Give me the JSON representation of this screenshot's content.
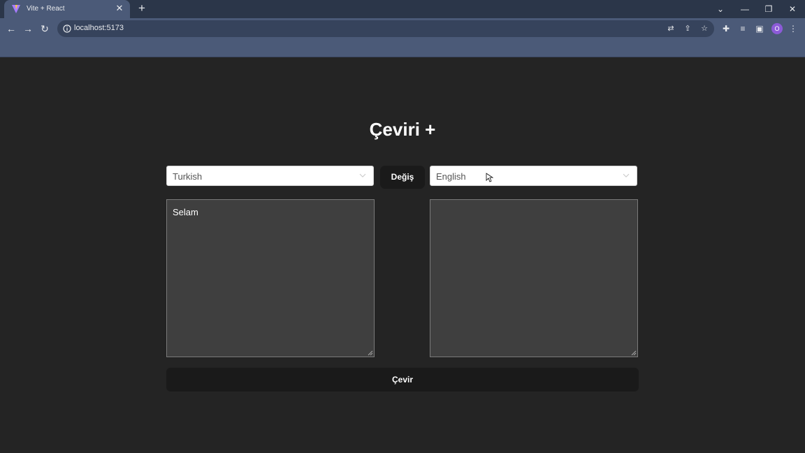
{
  "browser": {
    "tab_title": "Vite + React",
    "url": "localhost:5173",
    "profile_initial": "O",
    "icons": {
      "tab_close": "close-icon",
      "new_tab": "plus-icon",
      "tab_search": "chevron-down-icon",
      "minimize": "minimize-icon",
      "restore": "restore-icon",
      "close_window": "close-icon",
      "back": "back-arrow-icon",
      "forward": "forward-arrow-icon",
      "reload": "reload-icon",
      "site_info": "info-icon",
      "translate": "translate-icon",
      "share": "share-icon",
      "bookmark": "star-icon",
      "extensions": "puzzle-icon",
      "media": "playlist-icon",
      "side_panel": "side-panel-icon",
      "menu": "kebab-menu-icon"
    }
  },
  "app": {
    "title": "Çeviri +",
    "source_language": "Turkish",
    "target_language": "English",
    "swap_label": "Değiş",
    "source_text": "Selam",
    "target_text": "",
    "translate_label": "Çevir"
  },
  "colors": {
    "page_background": "#242424",
    "button_background": "#1a1a1a",
    "textarea_background": "#3f3f3f",
    "browser_chrome": "#4b5a78"
  }
}
